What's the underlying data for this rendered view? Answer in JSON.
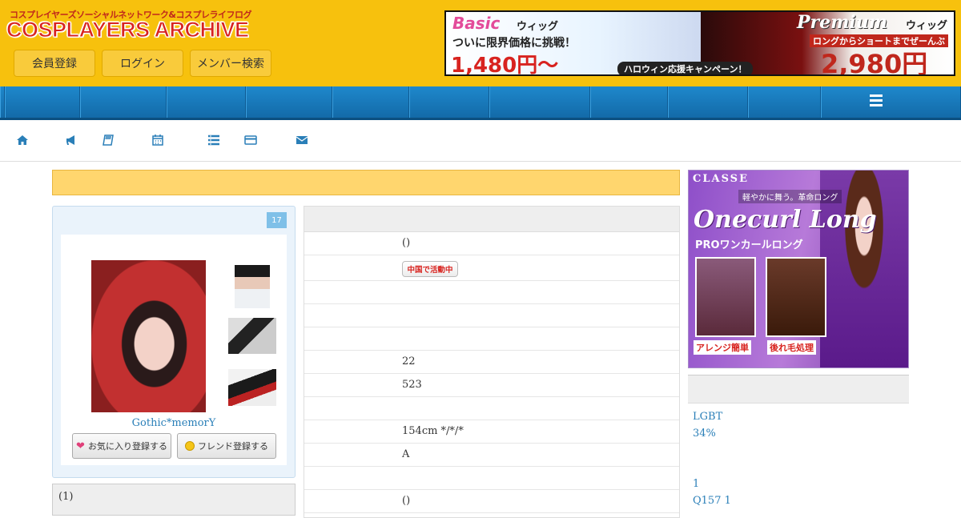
{
  "header": {
    "logo_sub": "コスプレイヤーズソーシャルネットワーク&コスプレライフログ",
    "logo_main": "COSPLAYERS ARCHIVE",
    "buttons": [
      {
        "label": "会員登録"
      },
      {
        "label": "ログイン"
      },
      {
        "label": "メンバー検索"
      }
    ],
    "bg_color": "#f7c10d"
  },
  "banner": {
    "basic": "Basic",
    "basic_wig": "ウィッグ",
    "basic_line": "ついに限界価格に挑戦！",
    "basic_price": "1,480円～",
    "premium": "Premium",
    "premium_wig": "ウィッグ",
    "premium_line": "ロングからショートまでぜーんぶ",
    "premium_price": "2,980円",
    "campaign": "ハロウィン応援キャンペーン！"
  },
  "icon_nav": [
    {
      "icon": "home-icon"
    },
    {
      "icon": "megaphone-icon"
    },
    {
      "icon": "book-icon"
    },
    {
      "icon": "calendar-icon"
    },
    {
      "icon": "list-icon"
    },
    {
      "icon": "credit-card-icon"
    },
    {
      "icon": "envelope-icon"
    }
  ],
  "profile": {
    "badge": "17",
    "name": "Gothic*memorY",
    "favorite_button": "お気に入り登録する",
    "friend_button": "フレンド登録する"
  },
  "subpanel": {
    "label": "(1)"
  },
  "table": {
    "rows": [
      {
        "value": "()"
      },
      {
        "value": "",
        "badge": "中国で活動中"
      },
      {
        "value": ""
      },
      {
        "value": ""
      },
      {
        "value": ""
      },
      {
        "value": "22"
      },
      {
        "value": "523"
      },
      {
        "value": ""
      },
      {
        "value": "154cm */*/*"
      },
      {
        "value": "A"
      },
      {
        "value": ""
      },
      {
        "value": "()"
      }
    ]
  },
  "ad": {
    "brand": "CLASSE",
    "tag": "軽やかに舞う。革命ロング",
    "title": "Onecurl Long",
    "subtitle": "PROワンカールロング",
    "label1": "アレンジ簡単",
    "label2": "後れ毛処理"
  },
  "right_links": [
    "LGBT",
    "34%",
    "1",
    "Q157 1"
  ],
  "colors": {
    "accent": "#2a7fb8",
    "nav_blue": "#1e88cc",
    "notice": "#ffd66e"
  }
}
